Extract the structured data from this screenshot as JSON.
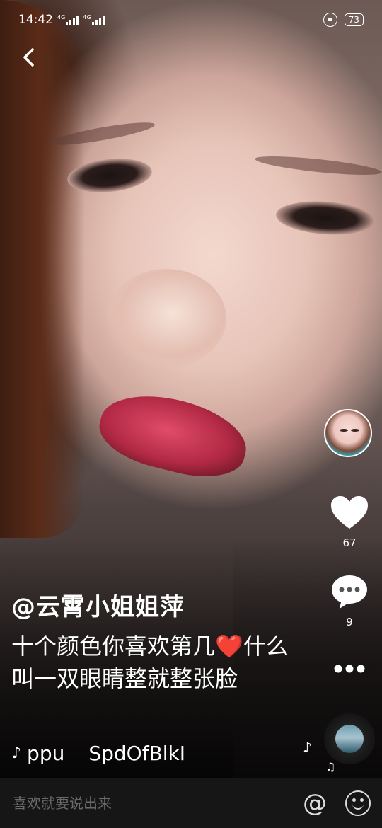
{
  "status_bar": {
    "time": "14:42",
    "network_1": "4G",
    "network_2": "4G",
    "battery": "73"
  },
  "post": {
    "author": "@云霄小姐姐萍",
    "description": "十个颜色你喜欢第几❤️什么叫一双眼睛整就整张脸",
    "music_prefix": "ppu",
    "music_title": "SpdOfBlkI"
  },
  "actions": {
    "like_count": "67",
    "comment_count": "9"
  },
  "comment_bar": {
    "placeholder": "喜欢就要说出来",
    "at_symbol": "@"
  },
  "icons": {
    "back": "chevron-left-icon",
    "like": "heart-icon",
    "comment": "speech-bubble-icon",
    "more": "ellipsis-icon",
    "music_note": "music-note-icon",
    "emoji": "smile-icon",
    "rotation_lock": "rotation-lock-icon"
  },
  "colors": {
    "bottom_bar": "#161616",
    "placeholder": "#6b6b6b"
  }
}
